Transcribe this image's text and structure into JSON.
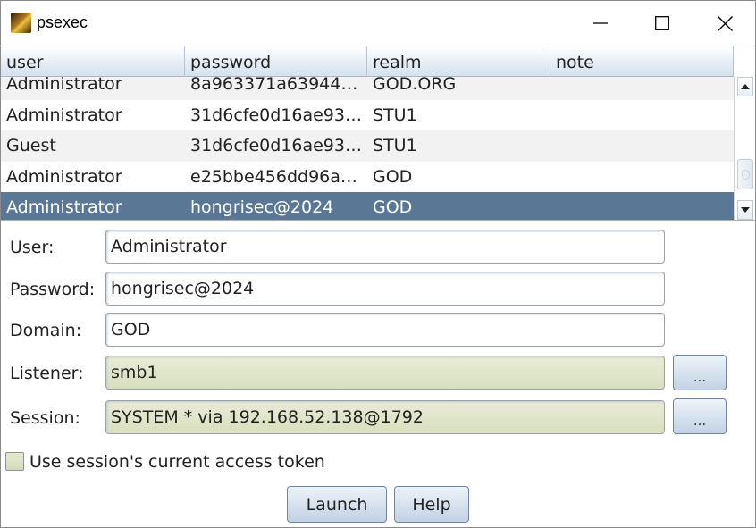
{
  "window": {
    "title": "psexec",
    "app_icon": "psexec-app-icon",
    "controls": {
      "minimize": "minimize-icon",
      "maximize": "maximize-icon",
      "close": "close-icon"
    }
  },
  "table": {
    "columns": [
      "user",
      "password",
      "realm",
      "note"
    ],
    "rows": [
      {
        "user": "Administrator",
        "password": "8a963371a63944…",
        "realm": "GOD.ORG",
        "note": ""
      },
      {
        "user": "Administrator",
        "password": "31d6cfe0d16ae93…",
        "realm": "STU1",
        "note": ""
      },
      {
        "user": "Guest",
        "password": "31d6cfe0d16ae93…",
        "realm": "STU1",
        "note": ""
      },
      {
        "user": "Administrator",
        "password": "e25bbe456dd96a…",
        "realm": "GOD",
        "note": ""
      },
      {
        "user": "Administrator",
        "password": "hongrisec@2024",
        "realm": "GOD",
        "note": ""
      }
    ],
    "selected_row": 4
  },
  "form": {
    "user_label": "User:",
    "user_value": "Administrator",
    "password_label": "Password:",
    "password_value": "hongrisec@2024",
    "domain_label": "Domain:",
    "domain_value": "GOD",
    "listener_label": "Listener:",
    "listener_value": "smb1",
    "session_label": "Session:",
    "session_value": "SYSTEM * via  192.168.52.138@1792",
    "listener_button": "...",
    "session_button": "...",
    "token_checkbox_label": "Use session's current access token",
    "token_checked": false
  },
  "buttons": {
    "launch": "Launch",
    "help": "Help"
  },
  "colors": {
    "selection": "#5a7896",
    "readonly_field": "#dde3c5",
    "header": "#dce6f1"
  }
}
